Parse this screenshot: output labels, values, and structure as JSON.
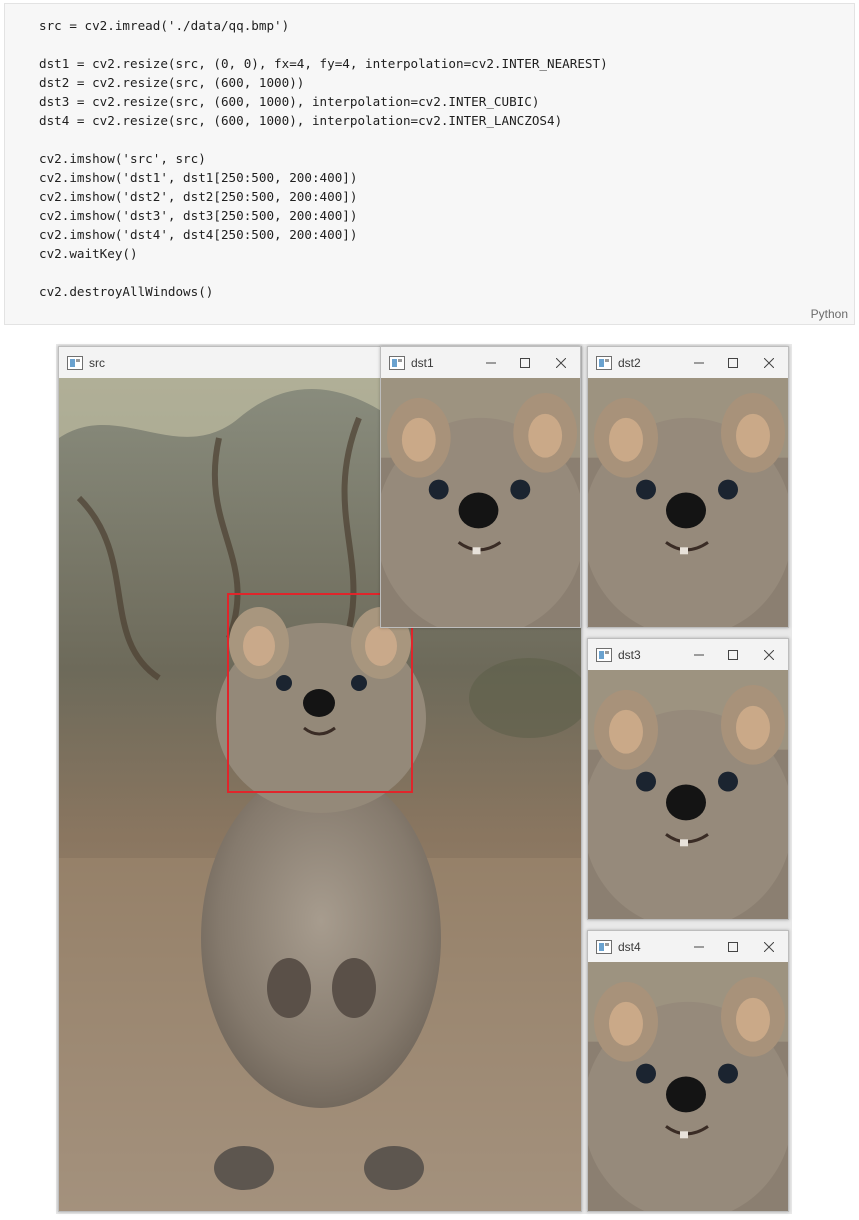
{
  "code": {
    "language_label": "Python",
    "lines": [
      "src = cv2.imread('./data/qq.bmp')",
      "",
      "dst1 = cv2.resize(src, (0, 0), fx=4, fy=4, interpolation=cv2.INTER_NEAREST)",
      "dst2 = cv2.resize(src, (600, 1000))",
      "dst3 = cv2.resize(src, (600, 1000), interpolation=cv2.INTER_CUBIC)",
      "dst4 = cv2.resize(src, (600, 1000), interpolation=cv2.INTER_LANCZOS4)",
      "",
      "cv2.imshow('src', src)",
      "cv2.imshow('dst1', dst1[250:500, 200:400])",
      "cv2.imshow('dst2', dst2[250:500, 200:400])",
      "cv2.imshow('dst3', dst3[250:500, 200:400])",
      "cv2.imshow('dst4', dst4[250:500, 200:400])",
      "cv2.waitKey()",
      "",
      "cv2.destroyAllWindows()"
    ]
  },
  "windows": {
    "src": {
      "title": "src"
    },
    "dst1": {
      "title": "dst1"
    },
    "dst2": {
      "title": "dst2"
    },
    "dst3": {
      "title": "dst3"
    },
    "dst4": {
      "title": "dst4"
    }
  },
  "controls": {
    "minimize": "minimize-icon",
    "maximize": "maximize-icon",
    "close": "close-icon"
  },
  "colors": {
    "selection_rect": "#e0252b",
    "titlebar": "#f3f3f3"
  }
}
